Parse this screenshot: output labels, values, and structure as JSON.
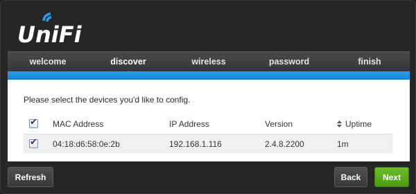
{
  "brand": {
    "logo_text": "UniFi",
    "accent_color": "#1f8ddf",
    "next_color": "#5aac1f"
  },
  "nav": {
    "items": [
      {
        "label": "welcome"
      },
      {
        "label": "discover"
      },
      {
        "label": "wireless"
      },
      {
        "label": "password"
      },
      {
        "label": "finish"
      }
    ],
    "active_index": 1
  },
  "main": {
    "prompt": "Please select the devices you'd like to config.",
    "table": {
      "select_all_checked": true,
      "columns": [
        "MAC Address",
        "IP Address",
        "Version",
        "Uptime"
      ],
      "sort_icon": "sort-updown-icon",
      "rows": [
        {
          "checked": true,
          "mac": "04:18:d6:58:0e:2b",
          "ip": "192.168.1.116",
          "version": "2.4.8.2200",
          "uptime": "1m"
        }
      ]
    }
  },
  "footer": {
    "refresh_label": "Refresh",
    "back_label": "Back",
    "next_label": "Next"
  }
}
